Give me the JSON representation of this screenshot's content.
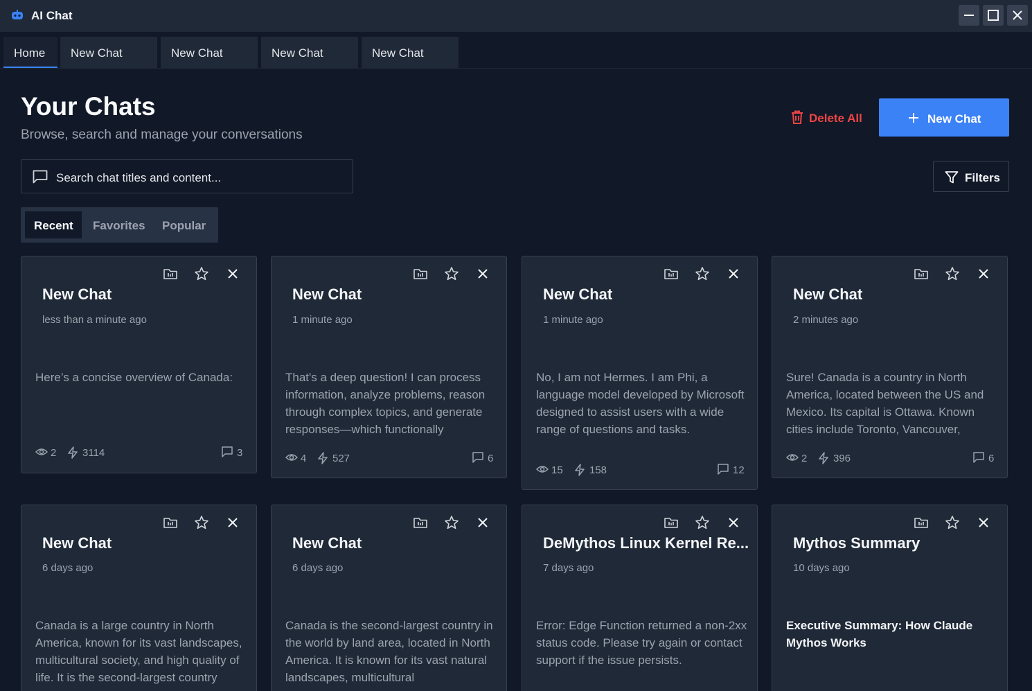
{
  "window": {
    "title": "AI Chat"
  },
  "tabs": [
    "Home",
    "New Chat",
    "New Chat",
    "New Chat",
    "New Chat"
  ],
  "header": {
    "title": "Your Chats",
    "subtitle": "Browse, search and manage your conversations",
    "delete_all": "Delete All",
    "new_chat": "New Chat"
  },
  "search": {
    "placeholder": "Search chat titles and content..."
  },
  "filters_label": "Filters",
  "segments": [
    "Recent",
    "Favorites",
    "Popular"
  ],
  "accent_color": "#3b82f6",
  "danger_color": "#ef4444",
  "cards": [
    {
      "title": "New Chat",
      "time": "less than a minute ago",
      "preview": "Here’s a concise overview of Canada:",
      "views": "2",
      "tokens": "3114",
      "messages": "3"
    },
    {
      "title": "New Chat",
      "time": "1 minute ago",
      "preview": "That's a deep question! I can process information, analyze problems, reason through complex topics, and generate responses—which functionally",
      "views": "4",
      "tokens": "527",
      "messages": "6"
    },
    {
      "title": "New Chat",
      "time": "1 minute ago",
      "preview": "No, I am not Hermes. I am Phi, a language model developed by Microsoft designed to assist users with a wide range of questions and tasks.",
      "views": "15",
      "tokens": "158",
      "messages": "12"
    },
    {
      "title": "New Chat",
      "time": "2 minutes ago",
      "preview": "Sure! Canada is a country in North America, located between the US and Mexico. Its capital is Ottawa. Known cities include Toronto, Vancouver,",
      "views": "2",
      "tokens": "396",
      "messages": "6"
    },
    {
      "title": "New Chat",
      "time": "6 days ago",
      "preview": "Canada is a large country in North America, known for its vast landscapes, multicultural society, and high quality of life. It is the second-largest country"
    },
    {
      "title": "New Chat",
      "time": "6 days ago",
      "preview": "Canada is the second-largest country in the world by land area, located in North America. It is known for its vast natural landscapes, multicultural"
    },
    {
      "title": "DeMythos Linux Kernel Re...",
      "time": "7 days ago",
      "preview": "Error: Edge Function returned a non-2xx status code. Please try again or contact support if the issue persists."
    },
    {
      "title": "Mythos Summary",
      "time": "10 days ago",
      "preview": "Executive Summary: How Claude Mythos Works"
    }
  ]
}
